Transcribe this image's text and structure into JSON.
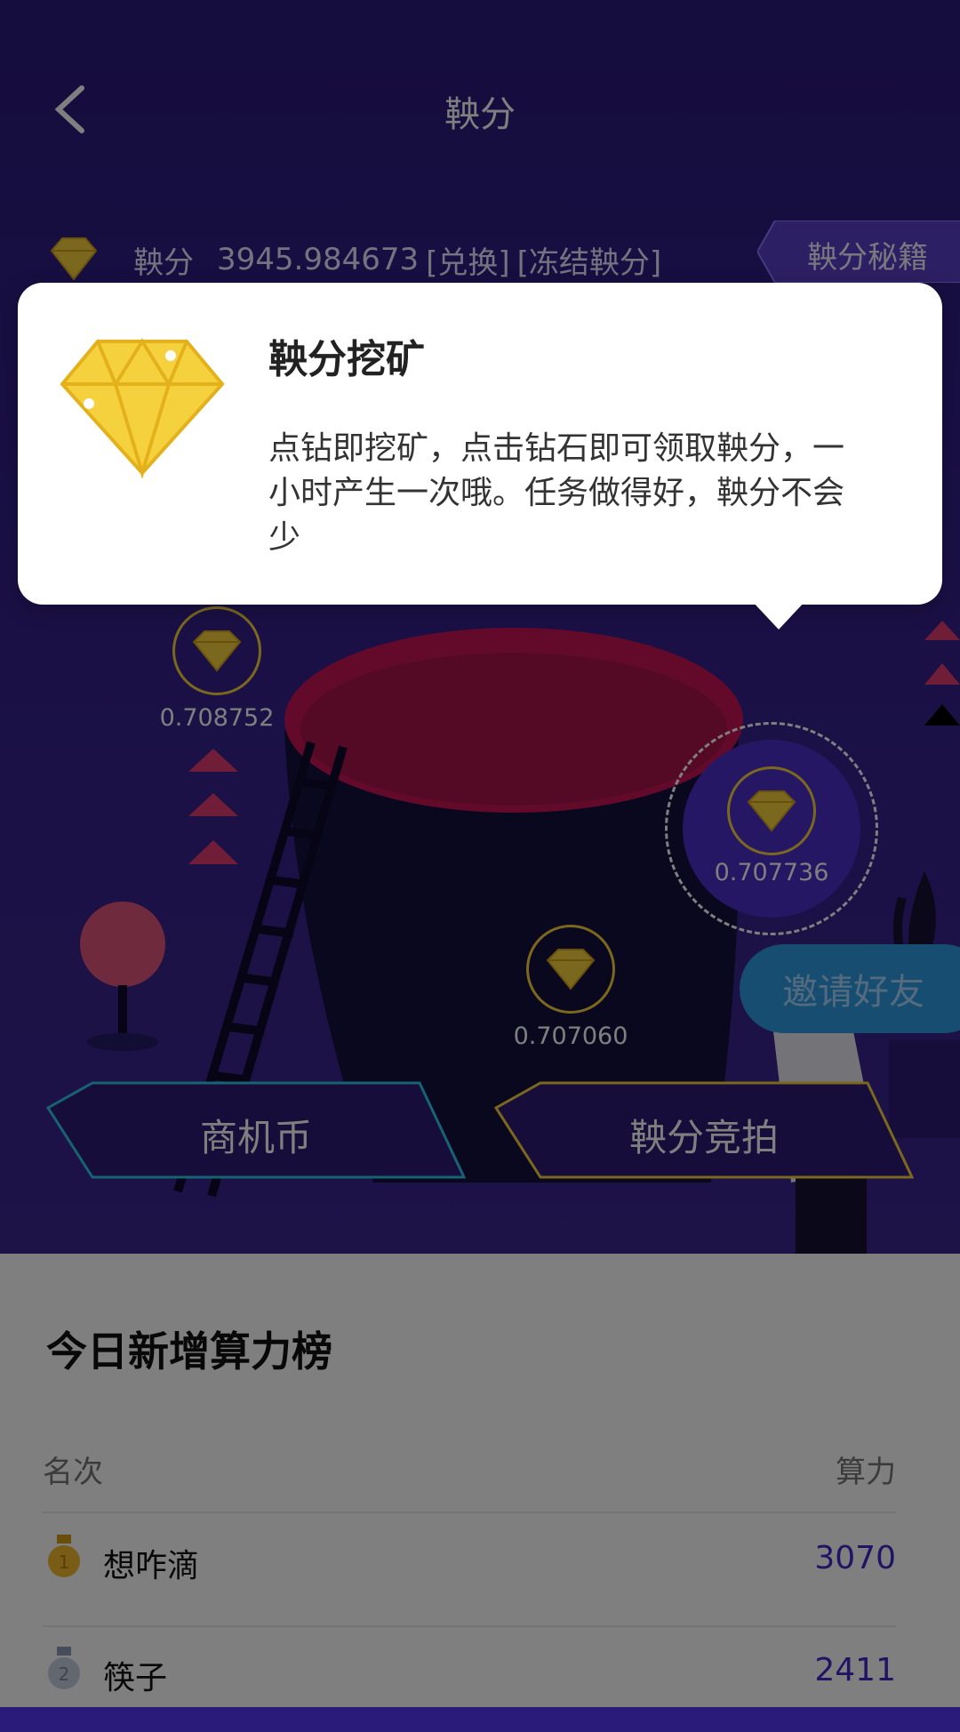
{
  "header": {
    "title": "鞅分"
  },
  "score": {
    "label": "鞅分",
    "value": "3945.984673",
    "exchange": "[兑换]",
    "frozen": "[冻结鞅分]"
  },
  "tips_button": {
    "label": "鞅分秘籍"
  },
  "popup": {
    "title": "鞅分挖矿",
    "text": "点钻即挖矿，点击钻石即可领取鞅分，一小时产生一次哦。任务做得好，鞅分不会少"
  },
  "mines": [
    {
      "value": "0.708752"
    },
    {
      "value": "0.707736"
    },
    {
      "value": "0.707060"
    }
  ],
  "invite_button": {
    "label": "邀请好友"
  },
  "actions": {
    "left_label": "商机币",
    "right_label": "鞅分竞拍"
  },
  "ranking": {
    "title": "今日新增算力榜",
    "col_rank": "名次",
    "col_power": "算力",
    "rows": [
      {
        "badge": "1",
        "name": "想咋滴",
        "power": "3070"
      },
      {
        "badge": "2",
        "name": "筷子",
        "power": "2411"
      }
    ]
  },
  "colors": {
    "bg": "#2a1a7a",
    "accent": "#3f2bc8",
    "gold": "#f6d13e",
    "cyan": "#2ec6e6",
    "invite": "#2d9be0"
  }
}
